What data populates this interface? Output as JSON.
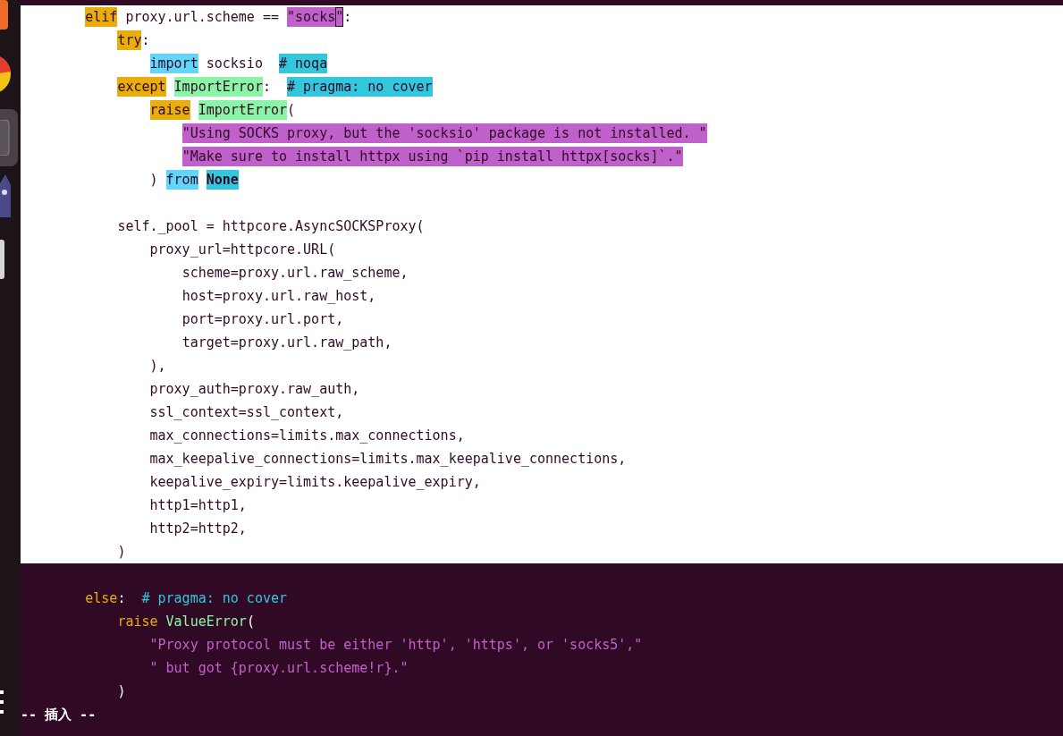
{
  "dock": {
    "items": [
      {
        "kind": "orange",
        "selected": false
      },
      {
        "kind": "browser",
        "selected": false
      },
      {
        "kind": "terminal",
        "selected": true
      },
      {
        "kind": "cat",
        "selected": false
      },
      {
        "kind": "disk",
        "selected": false
      }
    ]
  },
  "editor": {
    "lines": [
      {
        "highlighted": true,
        "segments": [
          {
            "kind": "keyword",
            "text": "        elif"
          },
          {
            "kind": "plain",
            "text": " proxy.url.scheme == "
          },
          {
            "kind": "string",
            "text": "\"socks"
          },
          {
            "kind": "string",
            "text": "\"",
            "cursor": true
          },
          {
            "kind": "plain",
            "text": ":"
          }
        ]
      },
      {
        "highlighted": true,
        "segments": [
          {
            "kind": "keyword",
            "text": "            try"
          },
          {
            "kind": "plain",
            "text": ":"
          }
        ]
      },
      {
        "highlighted": true,
        "segments": [
          {
            "kind": "import",
            "text": "                import"
          },
          {
            "kind": "plain",
            "text": " socksio  "
          },
          {
            "kind": "comment",
            "text": "# noqa"
          }
        ]
      },
      {
        "highlighted": true,
        "segments": [
          {
            "kind": "keyword",
            "text": "            except "
          },
          {
            "kind": "type",
            "text": "ImportError"
          },
          {
            "kind": "plain",
            "text": ":  "
          },
          {
            "kind": "comment",
            "text": "# pragma: no cover"
          }
        ]
      },
      {
        "highlighted": true,
        "segments": [
          {
            "kind": "keyword",
            "text": "                raise "
          },
          {
            "kind": "type",
            "text": "ImportError"
          },
          {
            "kind": "plain",
            "text": "("
          }
        ]
      },
      {
        "highlighted": true,
        "segments": [
          {
            "kind": "string",
            "text": "                    \"Using SOCKS proxy, but the 'socksio' package is not installed. \""
          }
        ]
      },
      {
        "highlighted": true,
        "segments": [
          {
            "kind": "string",
            "text": "                    \"Make sure to install httpx using `pip install httpx[socks]`.\""
          }
        ]
      },
      {
        "highlighted": true,
        "segments": [
          {
            "kind": "plain",
            "text": "                ) "
          },
          {
            "kind": "import",
            "text": "from "
          },
          {
            "kind": "constant",
            "text": "None"
          }
        ]
      },
      {
        "highlighted": true
      },
      {
        "highlighted": true,
        "segments": [
          {
            "kind": "plain",
            "text": "            self._pool = httpcore.AsyncSOCKSProxy("
          }
        ]
      },
      {
        "highlighted": true,
        "segments": [
          {
            "kind": "plain",
            "text": "                proxy_url=httpcore.URL("
          }
        ]
      },
      {
        "highlighted": true,
        "segments": [
          {
            "kind": "plain",
            "text": "                    scheme=proxy.url.raw_scheme,"
          }
        ]
      },
      {
        "highlighted": true,
        "segments": [
          {
            "kind": "plain",
            "text": "                    host=proxy.url.raw_host,"
          }
        ]
      },
      {
        "highlighted": true,
        "segments": [
          {
            "kind": "plain",
            "text": "                    port=proxy.url.port,"
          }
        ]
      },
      {
        "highlighted": true,
        "segments": [
          {
            "kind": "plain",
            "text": "                    target=proxy.url.raw_path,"
          }
        ]
      },
      {
        "highlighted": true,
        "segments": [
          {
            "kind": "plain",
            "text": "                ),"
          }
        ]
      },
      {
        "highlighted": true,
        "segments": [
          {
            "kind": "plain",
            "text": "                proxy_auth=proxy.raw_auth,"
          }
        ]
      },
      {
        "highlighted": true,
        "segments": [
          {
            "kind": "plain",
            "text": "                ssl_context=ssl_context,"
          }
        ]
      },
      {
        "highlighted": true,
        "segments": [
          {
            "kind": "plain",
            "text": "                max_connections=limits.max_connections,"
          }
        ]
      },
      {
        "highlighted": true,
        "segments": [
          {
            "kind": "plain",
            "text": "                max_keepalive_connections=limits.max_keepalive_connections,"
          }
        ]
      },
      {
        "highlighted": true,
        "segments": [
          {
            "kind": "plain",
            "text": "                keepalive_expiry=limits.keepalive_expiry,"
          }
        ]
      },
      {
        "highlighted": true,
        "segments": [
          {
            "kind": "plain",
            "text": "                http1=http1,"
          }
        ]
      },
      {
        "highlighted": true,
        "segments": [
          {
            "kind": "plain",
            "text": "                http2=http2,"
          }
        ]
      },
      {
        "highlighted": true,
        "segments": [
          {
            "kind": "plain",
            "text": "            )"
          }
        ]
      },
      {
        "highlighted": false
      },
      {
        "highlighted": false,
        "segments": [
          {
            "kind": "keyword",
            "text": "        else"
          },
          {
            "kind": "plain",
            "text": ":  "
          },
          {
            "kind": "comment",
            "text": "# pragma: no cover"
          }
        ]
      },
      {
        "highlighted": false,
        "segments": [
          {
            "kind": "keyword",
            "text": "            raise "
          },
          {
            "kind": "type",
            "text": "ValueError"
          },
          {
            "kind": "plain",
            "text": "("
          }
        ]
      },
      {
        "highlighted": false,
        "segments": [
          {
            "kind": "string",
            "text": "                \"Proxy protocol must be either 'http', 'https', or 'socks5',\""
          }
        ]
      },
      {
        "highlighted": false,
        "segments": [
          {
            "kind": "string",
            "text": "                \" but got {proxy.url.scheme!r}.\""
          }
        ]
      },
      {
        "highlighted": false,
        "segments": [
          {
            "kind": "plain",
            "text": "            )"
          }
        ]
      }
    ]
  },
  "mode_line": "-- 插入 --"
}
